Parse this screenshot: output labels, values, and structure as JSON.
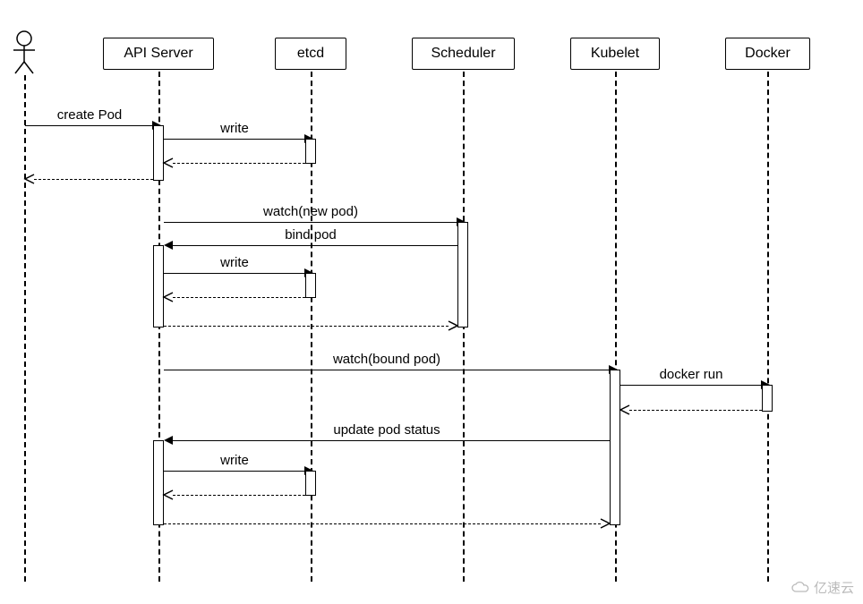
{
  "participants": {
    "actor": "",
    "api_server": "API Server",
    "etcd": "etcd",
    "scheduler": "Scheduler",
    "kubelet": "Kubelet",
    "docker": "Docker"
  },
  "messages": {
    "create_pod": "create Pod",
    "write1": "write",
    "watch_new_pod": "watch(new pod)",
    "bind_pod": "bind pod",
    "write2": "write",
    "watch_bound_pod": "watch(bound pod)",
    "docker_run": "docker run",
    "update_pod_status": "update pod status",
    "write3": "write"
  },
  "watermark": "亿速云"
}
